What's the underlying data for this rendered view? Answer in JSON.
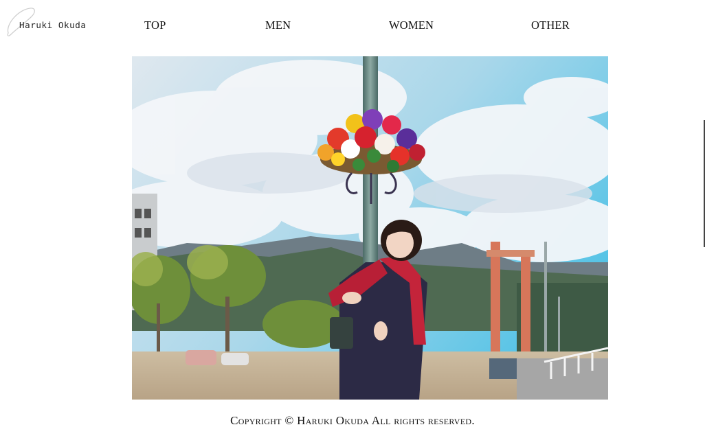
{
  "logo": {
    "text": "Haruki Okuda"
  },
  "nav": {
    "items": [
      {
        "label": "TOP"
      },
      {
        "label": "MEN"
      },
      {
        "label": "WOMEN"
      },
      {
        "label": "OTHER"
      }
    ]
  },
  "hero": {
    "image": "photo of a woman in a red scarf hugging a lamp post with a flower basket, under a blue cloudy sky"
  },
  "footer": {
    "copyright": "Copyright © Haruki Okuda All rights reserved."
  },
  "colors": {
    "sky_top": "#5fc9e8",
    "cloud": "#eef3f8",
    "pole": "#5e7e78",
    "scarf": "#c4243a",
    "coat": "#2c2a45",
    "ground": "#c9b79a"
  }
}
